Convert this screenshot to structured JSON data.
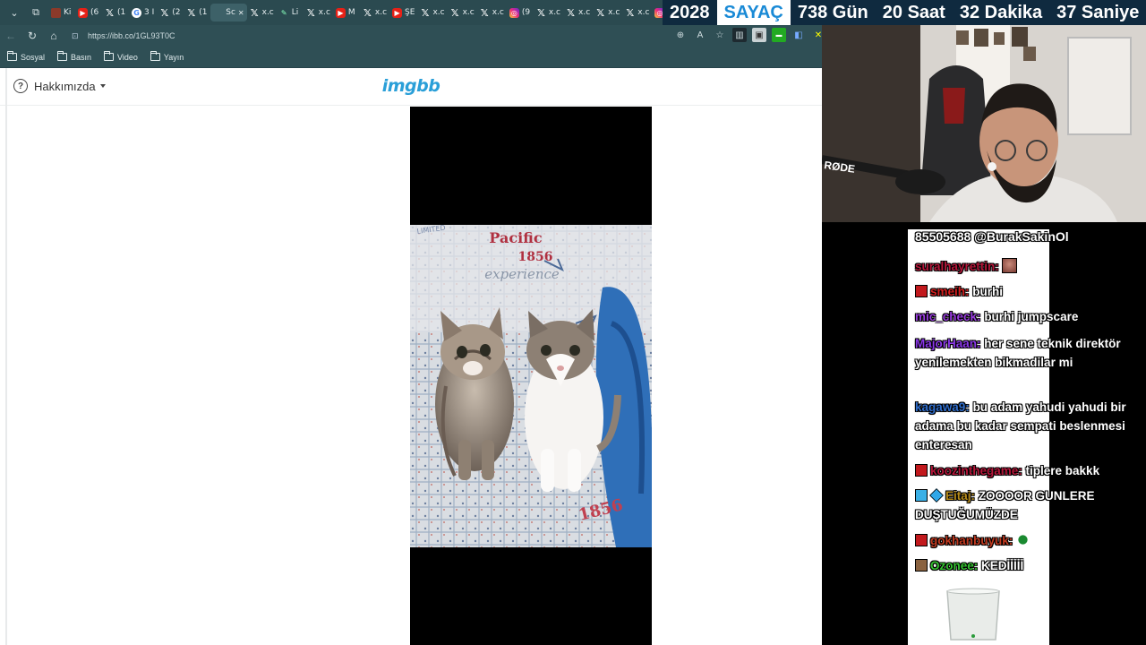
{
  "browser": {
    "tabs": [
      {
        "icon": "brown-favicon",
        "label": "Ki"
      },
      {
        "icon": "youtube-icon",
        "label": "(6"
      },
      {
        "icon": "x-icon",
        "label": "(1"
      },
      {
        "icon": "google-icon",
        "label": "3 I"
      },
      {
        "icon": "x-icon",
        "label": "(2"
      },
      {
        "icon": "x-icon",
        "label": "(1"
      },
      {
        "icon": "sc-favicon",
        "label": "Sc",
        "active": true
      },
      {
        "icon": "x-icon",
        "label": "x.c"
      },
      {
        "icon": "feather-icon",
        "label": "Li"
      },
      {
        "icon": "x-icon",
        "label": "x.c"
      },
      {
        "icon": "youtube-icon",
        "label": "M"
      },
      {
        "icon": "x-icon",
        "label": "x.c"
      },
      {
        "icon": "youtube-icon",
        "label": "ŞE"
      },
      {
        "icon": "x-icon",
        "label": "x.c"
      },
      {
        "icon": "x-icon",
        "label": "x.c"
      },
      {
        "icon": "x-icon",
        "label": "x.c"
      },
      {
        "icon": "instagram-icon",
        "label": "(9"
      },
      {
        "icon": "x-icon",
        "label": "x.c"
      },
      {
        "icon": "x-icon",
        "label": "x.c"
      },
      {
        "icon": "x-icon",
        "label": "x.c"
      },
      {
        "icon": "x-icon",
        "label": "x.c"
      },
      {
        "icon": "instagram-icon",
        "label": "(9"
      },
      {
        "icon": "x-icon",
        "label": "x.c"
      }
    ],
    "url": "https://ibb.co/1GL93T0C",
    "bookmarks": [
      "Sosyal",
      "Basın",
      "Video",
      "Yayın"
    ]
  },
  "page": {
    "about_label": "Hakkımızda",
    "logo": "imgbb"
  },
  "photo": {
    "print_line1": "Pacific",
    "print_line2": "1856",
    "print_line3": "experience",
    "print_bottom": "1856",
    "print_side": "LIMITED"
  },
  "counter": {
    "year": "2028",
    "label": "SAYAÇ",
    "days": "738 Gün",
    "hours": "20 Saat",
    "minutes": "32 Dakika",
    "seconds": "37 Saniye"
  },
  "chat": {
    "top_line": "85505688 @BurakSakinOl",
    "messages": [
      {
        "user": "suralhayrettin:",
        "text": ""
      },
      {
        "user": "smeih:",
        "text": "burhi"
      },
      {
        "user": "mic_check:",
        "text": "burhi jumpscare"
      },
      {
        "user": "MajorHaan:",
        "text": "her sene teknik direktör yenilemekten bikmadilar mi"
      },
      {
        "user": "kagawa9:",
        "text": "bu adam yahudi yahudi bir adama bu kadar sempati beslenmesi enteresan"
      },
      {
        "user": "koozinthegame:",
        "text": "tiplere bakkk"
      },
      {
        "user": "Eitaj:",
        "text": "ZOOOOR GUNLERE DUŞTUĞUMÜZDE"
      },
      {
        "user": "gokhanbuyuk:",
        "text": ""
      },
      {
        "user": "Ozonee:",
        "text": "KEDİİİİİ"
      }
    ]
  },
  "colors": {
    "browser_chrome": "#2f4f55",
    "logo_blue": "#2a9fd8",
    "counter_bg": "#0f2a3f",
    "counter_label": "#1a8ad6"
  }
}
